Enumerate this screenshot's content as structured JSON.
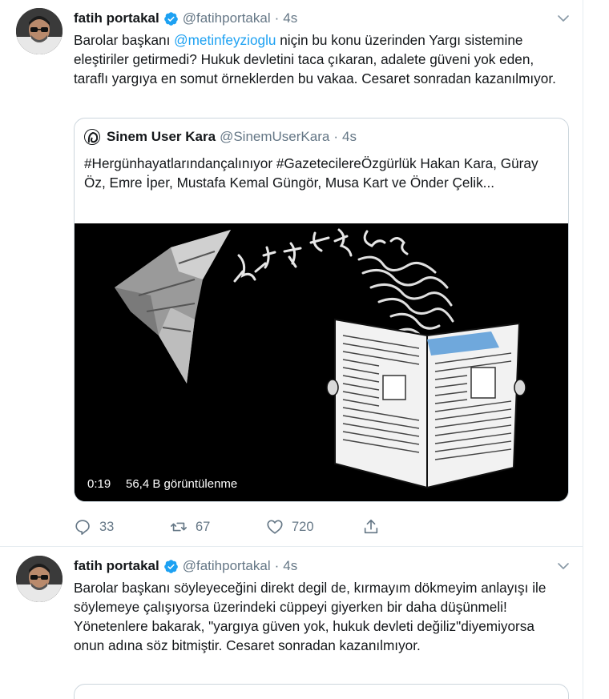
{
  "tweets": [
    {
      "author_name": "fatih portakal",
      "handle": "@fatihportakal",
      "separator": "·",
      "time": "4s",
      "text_before_mention": "Barolar başkanı ",
      "mention": "@metinfeyzioglu",
      "text_after_mention": " niçin bu konu üzerinden Yargı sistemine eleştiriler getirmedi? Hukuk devletini taca çıkaran, adalete güveni yok eden, taraflı yargıya en somut örneklerden bu vakaa. Cesaret sonradan kazanılmıyor.",
      "quoted": {
        "author_name": "Sinem User Kara",
        "handle": "@SinemUserKara",
        "separator": "·",
        "time": "4s",
        "text": "#Hergünhayatlarındançalınıyor  #GazetecilereÖzgürlük    Hakan Kara, Güray Öz, Emre İper, Mustafa Kemal Güngör, Musa Kart ve Önder Çelik...",
        "video": {
          "duration": "0:19",
          "views": "56,4 B görüntülenme"
        }
      },
      "actions": {
        "replies": "33",
        "retweets": "67",
        "likes": "720"
      }
    },
    {
      "author_name": "fatih portakal",
      "handle": "@fatihportakal",
      "separator": "·",
      "time": "4s",
      "text": "Barolar başkanı söyleyeceğini direkt degil de, kırmayım dökmeyim anlayışı ile söylemeye çalışıyorsa üzerindeki cüppeyi giyerken bir daha düşünmeli! Yönetenlere bakarak, \"yargıya güven yok, hukuk devleti değiliz\"diyemiyorsa onun adına söz bitmiştir. Cesaret sonradan kazanılmıyor."
    }
  ],
  "colors": {
    "accent": "#1da1f2",
    "muted": "#657786",
    "border": "#e6ecf0",
    "verified": "#1da1f2"
  },
  "icons": [
    "verified-badge-icon",
    "chevron-down-icon",
    "reply-icon",
    "retweet-icon",
    "like-icon",
    "share-icon"
  ]
}
